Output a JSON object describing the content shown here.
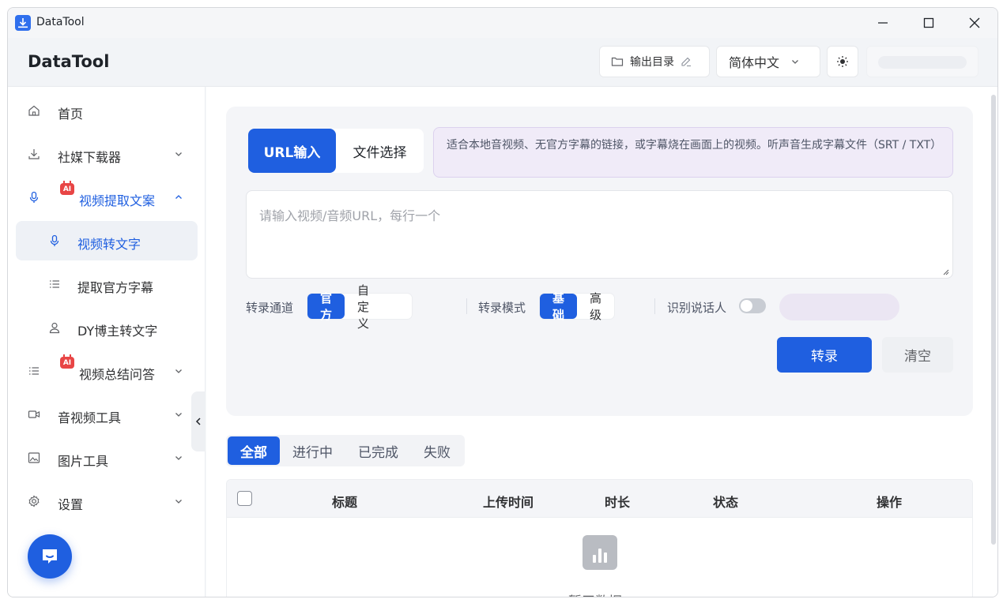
{
  "window": {
    "title": "DataTool"
  },
  "header": {
    "brand": "DataTool",
    "output_dir_label": "输出目录",
    "language": "简体中文"
  },
  "sidebar": {
    "items": [
      {
        "label": "首页",
        "icon": "home-icon"
      },
      {
        "label": "社媒下载器",
        "icon": "download-icon"
      },
      {
        "label": "视频提取文案",
        "icon": "microphone-icon",
        "badge": "AI"
      },
      {
        "label": "视频转文字",
        "icon": "microphone-icon"
      },
      {
        "label": "提取官方字幕",
        "icon": "list-icon"
      },
      {
        "label": "DY博主转文字",
        "icon": "user-icon"
      },
      {
        "label": "视频总结问答",
        "icon": "list-icon",
        "badge": "AI"
      },
      {
        "label": "音视频工具",
        "icon": "video-icon"
      },
      {
        "label": "图片工具",
        "icon": "image-icon"
      },
      {
        "label": "设置",
        "icon": "gear-icon"
      }
    ]
  },
  "main": {
    "input_tabs": [
      "URL输入",
      "文件选择"
    ],
    "hint": "适合本地音视频、无官方字幕的链接，或字幕烧在画面上的视频。听声音生成字幕文件（SRT / TXT）",
    "url_placeholder": "请输入视频/音频URL，每行一个",
    "channel_label": "转录通道",
    "channel_options": [
      "官方",
      "自定义"
    ],
    "mode_label": "转录模式",
    "mode_options": [
      "基础",
      "高级"
    ],
    "speaker_label": "识别说话人",
    "speaker_enabled": false,
    "transcribe_button": "转录",
    "clear_button": "清空",
    "filter_tabs": [
      "全部",
      "进行中",
      "已完成",
      "失败"
    ],
    "table_headers": [
      "标题",
      "上传时间",
      "时长",
      "状态",
      "操作"
    ],
    "empty_text": "暂无数据"
  },
  "colors": {
    "accent": "#1f5fe0",
    "ai_badge": "#e84545",
    "hint_bg": "#f0ebf8"
  }
}
